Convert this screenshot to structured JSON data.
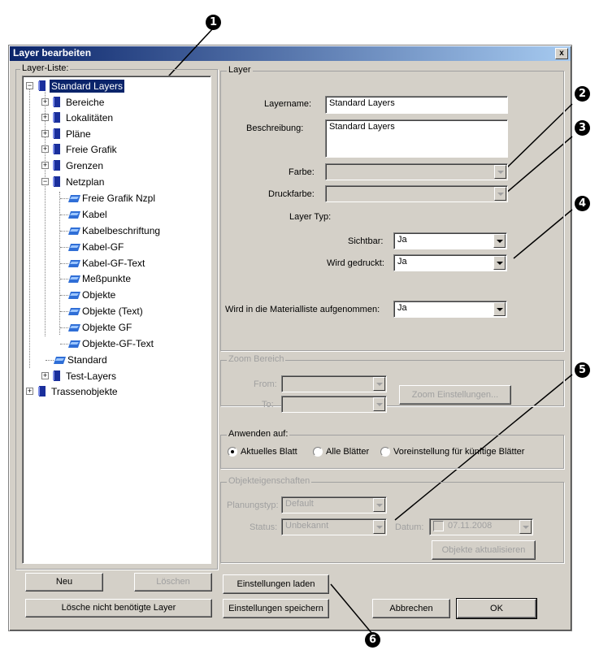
{
  "window": {
    "title": "Layer bearbeiten",
    "close_label": "x"
  },
  "callouts": [
    "1",
    "2",
    "3",
    "4",
    "5",
    "6"
  ],
  "tree": {
    "legend": "Layer-Liste:",
    "nodes": [
      {
        "label": "Standard Layers",
        "icon": "book-icon",
        "selected": true
      },
      {
        "label": "Bereiche",
        "icon": "book-icon"
      },
      {
        "label": "Lokalitäten",
        "icon": "book-icon"
      },
      {
        "label": "Pläne",
        "icon": "book-icon"
      },
      {
        "label": "Freie Grafik",
        "icon": "book-icon"
      },
      {
        "label": "Grenzen",
        "icon": "book-icon"
      },
      {
        "label": "Netzplan",
        "icon": "book-icon"
      },
      {
        "label": "Freie Grafik Nzpl",
        "icon": "layer-icon"
      },
      {
        "label": "Kabel",
        "icon": "layer-icon"
      },
      {
        "label": "Kabelbeschriftung",
        "icon": "layer-icon"
      },
      {
        "label": "Kabel-GF",
        "icon": "layer-icon"
      },
      {
        "label": "Kabel-GF-Text",
        "icon": "layer-icon"
      },
      {
        "label": "Meßpunkte",
        "icon": "layer-icon"
      },
      {
        "label": "Objekte",
        "icon": "layer-icon"
      },
      {
        "label": "Objekte (Text)",
        "icon": "layer-icon"
      },
      {
        "label": "Objekte GF",
        "icon": "layer-icon"
      },
      {
        "label": "Objekte-GF-Text",
        "icon": "layer-icon"
      },
      {
        "label": "Standard",
        "icon": "layer-icon"
      },
      {
        "label": "Test-Layers",
        "icon": "book-icon"
      },
      {
        "label": "Trassenobjekte",
        "icon": "book-icon"
      }
    ]
  },
  "left_buttons": {
    "new": "Neu",
    "delete": "Löschen",
    "delete_unused": "Lösche nicht benötigte Layer"
  },
  "layer": {
    "legend": "Layer",
    "name_label": "Layername:",
    "name_value": "Standard Layers",
    "desc_label": "Beschreibung:",
    "desc_value": "Standard Layers",
    "color_label": "Farbe:",
    "print_color_label": "Druckfarbe:",
    "type_label": "Layer Typ:",
    "visible_label": "Sichtbar:",
    "visible_value": "Ja",
    "printed_label": "Wird gedruckt:",
    "printed_value": "Ja",
    "material_label": "Wird in die Materialliste aufgenommen:",
    "material_value": "Ja"
  },
  "zoom": {
    "legend": "Zoom Bereich",
    "from_label": "From:",
    "to_label": "To:",
    "settings_button": "Zoom Einstellungen..."
  },
  "apply": {
    "legend": "Anwenden auf:",
    "options": [
      "Aktuelles Blatt",
      "Alle Blätter",
      "Voreinstellung für künftige Blätter"
    ],
    "selected_index": 0
  },
  "objects": {
    "legend": "Objekteigenschaften",
    "plan_type_label": "Planungstyp:",
    "plan_type_value": "Default",
    "status_label": "Status:",
    "status_value": "Unbekannt",
    "date_label": "Datum:",
    "date_value": "07.11.2008",
    "update_button": "Objekte aktualisieren"
  },
  "bottom_buttons": {
    "load": "Einstellungen laden",
    "save": "Einstellungen speichern",
    "cancel": "Abbrechen",
    "ok": "OK"
  }
}
